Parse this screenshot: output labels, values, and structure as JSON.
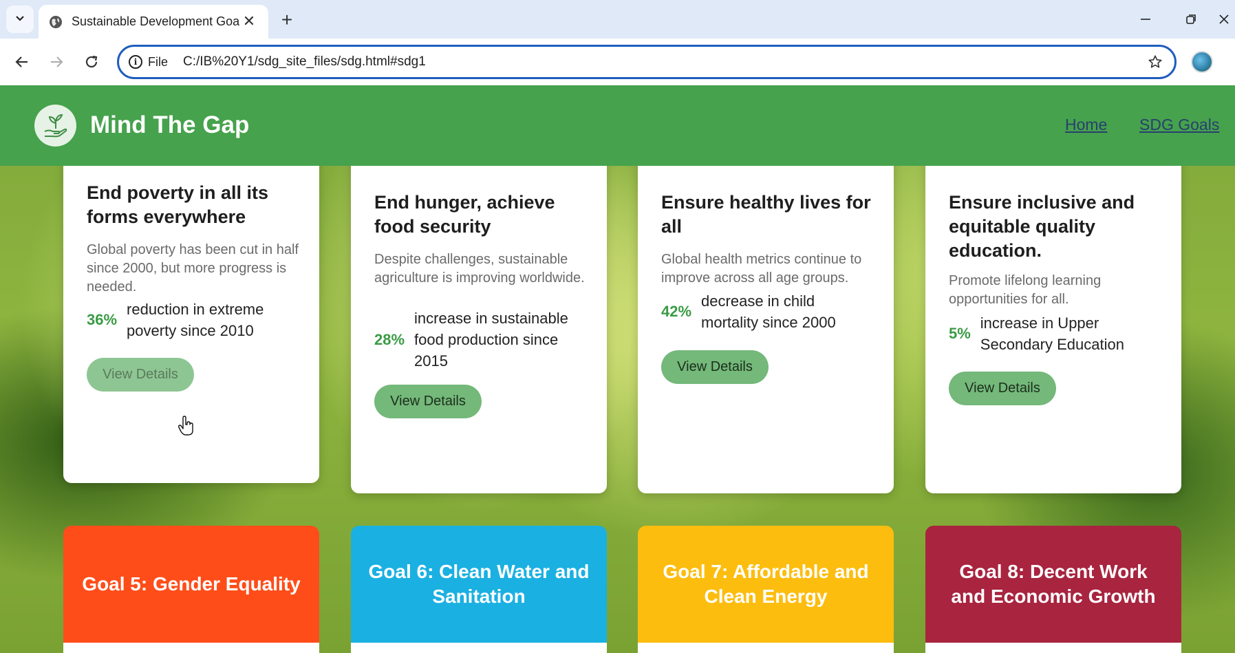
{
  "browser": {
    "tab_title": "Sustainable Development Goals",
    "address_prefix": "File",
    "url": "C:/IB%20Y1/sdg_site_files/sdg.html#sdg1"
  },
  "header": {
    "brand": "Mind The Gap",
    "nav": [
      "Home",
      "SDG Goals"
    ],
    "color": "#46a24c"
  },
  "cards": [
    {
      "band_color": "#e5392f",
      "title": "End poverty in all its forms everywhere",
      "description": "Global poverty has been cut in half since 2000, but more progress is needed.",
      "stat_value": "36%",
      "stat_text": "reduction in extreme poverty since 2010",
      "button": "View Details"
    },
    {
      "band_color": "#dea83a",
      "title": "End hunger, achieve food security",
      "description": "Despite challenges, sustainable agriculture is improving worldwide.",
      "stat_value": "28%",
      "stat_text": "increase in sustainable food production since 2015",
      "button": "View Details"
    },
    {
      "band_color": "#4c9f38",
      "title": "Ensure healthy lives for all",
      "description": "Global health metrics continue to improve across all age groups.",
      "stat_value": "42%",
      "stat_text": "decrease in child mortality since 2000",
      "button": "View Details"
    },
    {
      "band_color": "#d3302c",
      "title": "Ensure inclusive and equitable quality education.",
      "description": "Promote lifelong learning opportunities for all.",
      "stat_value": "5%",
      "stat_text": "increase in Upper Secondary Education",
      "button": "View Details"
    }
  ],
  "goals": [
    {
      "title": "Goal 5: Gender Equality",
      "color": "#ff4d1a"
    },
    {
      "title": "Goal 6: Clean Water and Sanitation",
      "color": "#1bb0e2"
    },
    {
      "title": "Goal 7: Affordable and Clean Energy",
      "color": "#fcbd0f"
    },
    {
      "title": "Goal 8: Decent Work and Economic Growth",
      "color": "#a8243f"
    }
  ]
}
